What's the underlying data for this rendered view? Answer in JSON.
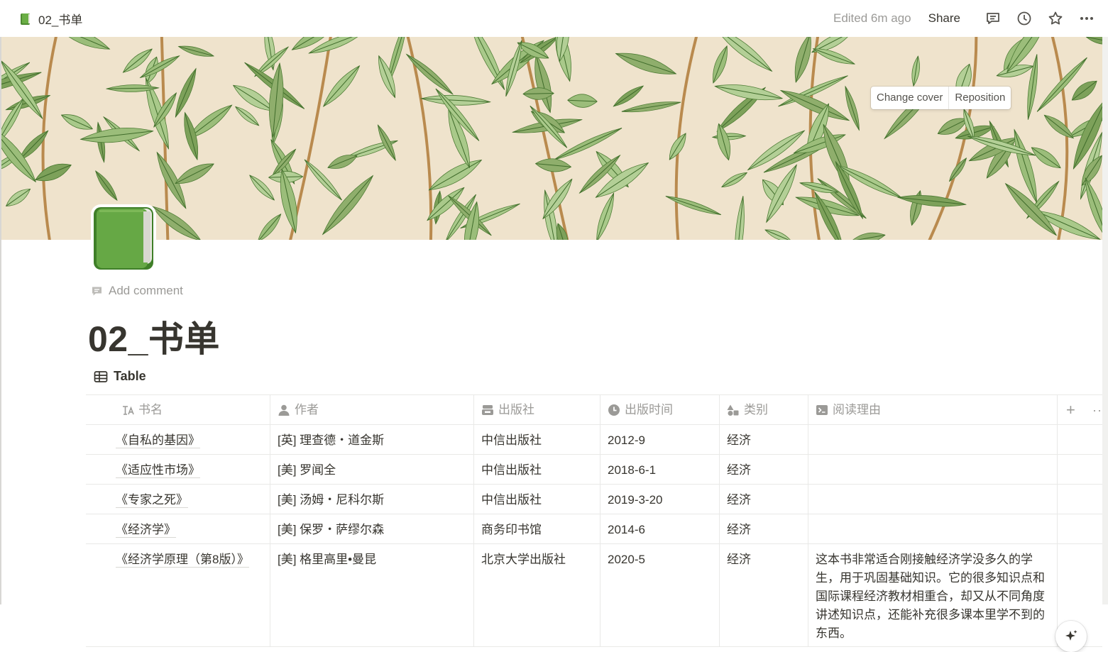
{
  "topbar": {
    "page_name": "02_书单",
    "edited": "Edited 6m ago",
    "share": "Share",
    "icons": [
      "comment-icon",
      "history-clock-icon",
      "star-icon",
      "more-icon"
    ]
  },
  "cover": {
    "change_cover": "Change cover",
    "reposition": "Reposition"
  },
  "page": {
    "icon": "green-book-icon",
    "add_comment": "Add comment",
    "title": "02_书单",
    "view_name": "Table"
  },
  "table": {
    "columns": [
      {
        "label": "书名",
        "icon": "title-aa-icon"
      },
      {
        "label": "作者",
        "icon": "person-icon"
      },
      {
        "label": "出版社",
        "icon": "select-icon"
      },
      {
        "label": "出版时间",
        "icon": "clock-icon"
      },
      {
        "label": "类别",
        "icon": "shapes-icon"
      },
      {
        "label": "阅读理由",
        "icon": "text-icon"
      }
    ],
    "add_column": "+",
    "rows": [
      {
        "title": "《自私的基因》",
        "author": "[英] 理查德・道金斯",
        "publisher": "中信出版社",
        "date": "2012-9",
        "category": "经济",
        "reason": ""
      },
      {
        "title": "《适应性市场》",
        "author": "[美] 罗闻全",
        "publisher": "中信出版社",
        "date": "2018-6-1",
        "category": "经济",
        "reason": ""
      },
      {
        "title": "《专家之死》",
        "author": "[美] 汤姆・尼科尔斯",
        "publisher": "中信出版社",
        "date": "2019-3-20",
        "category": "经济",
        "reason": ""
      },
      {
        "title": "《经济学》",
        "author": "[美] 保罗・萨缪尔森",
        "publisher": "商务印书馆",
        "date": "2014-6",
        "category": "经济",
        "reason": ""
      },
      {
        "title": "《经济学原理（第8版）》",
        "author": "[美] 格里高里•曼昆",
        "publisher": "北京大学出版社",
        "date": "2020-5",
        "category": "经济",
        "reason": "这本书非常适合刚接触经济学没多久的学生，用于巩固基础知识。它的很多知识点和国际课程经济教材相重合，却又从不同角度讲述知识点，还能补充很多课本里学不到的东西。"
      }
    ]
  },
  "colors": {
    "text": "#37352f",
    "muted": "#9b9a97",
    "border": "#e9e9e7",
    "cover_bg": "#efe3cc",
    "leaf_green": "#8fae6c",
    "book_green": "#5a9e3a"
  }
}
